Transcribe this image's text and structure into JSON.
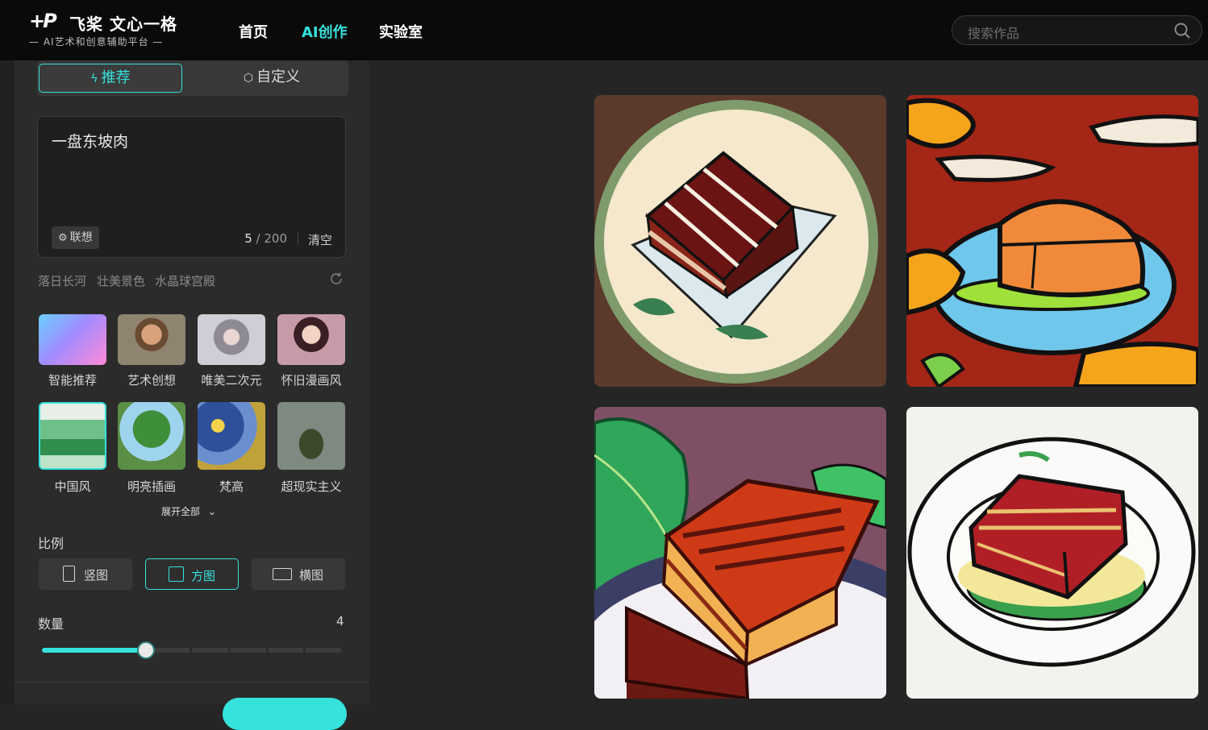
{
  "header": {
    "logo_mark": "+P",
    "logo_title": "飞桨 文心一格",
    "logo_subtitle": "— AI艺术和创意辅助平台 —",
    "nav": [
      {
        "label": "首页",
        "active": false
      },
      {
        "label": "AI创作",
        "active": true
      },
      {
        "label": "实验室",
        "active": false
      }
    ],
    "search_placeholder": "搜索作品"
  },
  "mode_tabs": [
    {
      "label": "推荐",
      "icon": "bolt-icon",
      "active": true
    },
    {
      "label": "自定义",
      "icon": "cube-icon",
      "active": false
    }
  ],
  "prompt": {
    "text": "一盘东坡肉",
    "assoc_label": "联想",
    "count": "5",
    "max": "/ 200",
    "clear_label": "清空"
  },
  "suggestions": [
    "落日长河",
    "壮美景色",
    "水晶球宫殿"
  ],
  "styles": [
    {
      "label": "智能推荐",
      "selected": false
    },
    {
      "label": "艺术创想",
      "selected": false
    },
    {
      "label": "唯美二次元",
      "selected": false
    },
    {
      "label": "怀旧漫画风",
      "selected": false
    },
    {
      "label": "中国风",
      "selected": true
    },
    {
      "label": "明亮插画",
      "selected": false
    },
    {
      "label": "梵高",
      "selected": false
    },
    {
      "label": "超现实主义",
      "selected": false
    }
  ],
  "expand_label": "展开全部",
  "ratio": {
    "title": "比例",
    "options": [
      {
        "label": "竖图",
        "selected": false
      },
      {
        "label": "方图",
        "selected": true
      },
      {
        "label": "横图",
        "selected": false
      }
    ]
  },
  "quantity": {
    "title": "数量",
    "value": "4",
    "level": 4,
    "max": 10
  },
  "colors": {
    "accent": "#35e2dc",
    "background": "#252525",
    "panel": "#2b2b2b",
    "header": "#0a0a0a"
  }
}
